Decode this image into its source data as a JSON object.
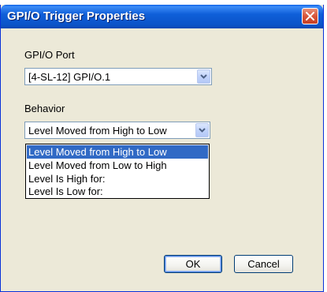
{
  "dialog": {
    "title": "GPI/O Trigger Properties"
  },
  "port": {
    "label": "GPI/O Port",
    "value": "[4-SL-12] GPI/O.1"
  },
  "behavior": {
    "label": "Behavior",
    "value": "Level Moved from High to Low",
    "options": [
      "Level Moved from High to Low",
      "Level Moved from Low to High",
      "Level Is High for:",
      "Level Is Low for:"
    ],
    "selected_index": 0
  },
  "buttons": {
    "ok": "OK",
    "cancel": "Cancel"
  },
  "colors": {
    "titlebar": "#0b53c8",
    "selection": "#316ac5",
    "dialog_bg": "#ece9d8",
    "close_button": "#d8553a"
  },
  "icons": {
    "close": "close-icon",
    "dropdown": "chevron-down-icon"
  }
}
